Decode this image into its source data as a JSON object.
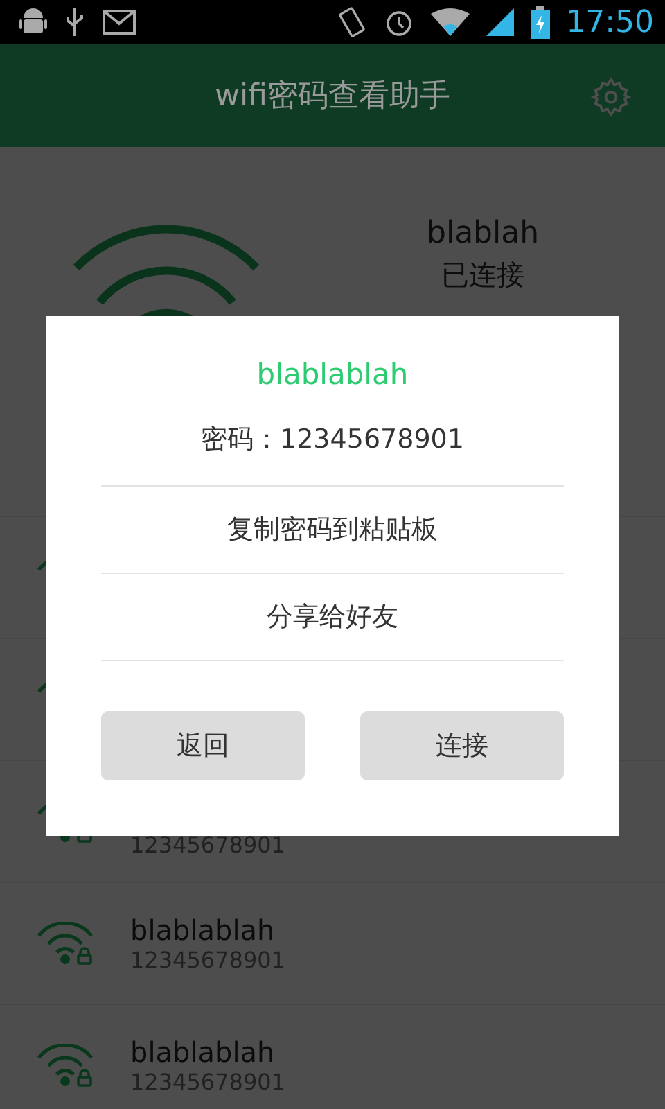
{
  "status_bar": {
    "time": "17:50"
  },
  "app_bar": {
    "title": "wifi密码查看助手"
  },
  "current": {
    "name": "blablah",
    "status": "已连接"
  },
  "networks": [
    {
      "password": "12345678901",
      "locked": true
    },
    {
      "name": "blablablah",
      "password": "12345678901",
      "locked": true
    },
    {
      "name": "blablablah",
      "password": "12345678901",
      "locked": true
    }
  ],
  "dialog": {
    "title": "blablablah",
    "password": "密码：12345678901",
    "actions": [
      "复制密码到粘贴板",
      "分享给好友"
    ],
    "buttons": [
      "返回",
      "连接"
    ]
  }
}
